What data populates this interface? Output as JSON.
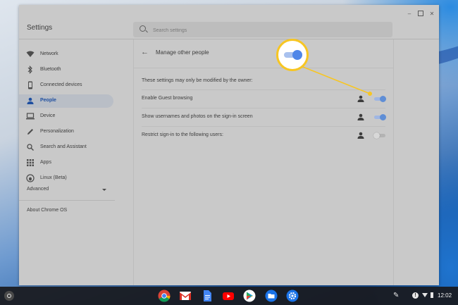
{
  "window": {
    "title": "Settings",
    "controls": {
      "minimize": "–",
      "close": "✕"
    }
  },
  "search": {
    "placeholder": "Search settings",
    "value": ""
  },
  "sidebar": {
    "items": [
      {
        "label": "Network",
        "icon": "wifi-icon",
        "active": false
      },
      {
        "label": "Bluetooth",
        "icon": "bluetooth-icon",
        "active": false
      },
      {
        "label": "Connected devices",
        "icon": "phone-icon",
        "active": false
      },
      {
        "label": "People",
        "icon": "person-icon",
        "active": true
      },
      {
        "label": "Device",
        "icon": "laptop-icon",
        "active": false
      },
      {
        "label": "Personalization",
        "icon": "pencil-icon",
        "active": false
      },
      {
        "label": "Search and Assistant",
        "icon": "search-icon",
        "active": false
      },
      {
        "label": "Apps",
        "icon": "apps-grid-icon",
        "active": false
      },
      {
        "label": "Linux (Beta)",
        "icon": "penguin-icon",
        "active": false
      }
    ],
    "advanced_label": "Advanced",
    "about_label": "About Chrome OS"
  },
  "page": {
    "back_icon": "back-arrow-icon",
    "back_glyph": "←",
    "title": "Manage other people",
    "owner_note": "These settings may only be modified by the owner:",
    "settings": [
      {
        "label": "Enable Guest browsing",
        "enabled": true,
        "icon": "person-icon"
      },
      {
        "label": "Show usernames and photos on the sign-in screen",
        "enabled": true,
        "icon": "person-icon"
      },
      {
        "label": "Restrict sign-in to the following users:",
        "enabled": false,
        "icon": "person-icon"
      }
    ]
  },
  "callout": {
    "highlights": "Enable Guest browsing toggle",
    "enabled": true
  },
  "shelf": {
    "apps": [
      "chrome-icon",
      "gmail-icon",
      "docs-icon",
      "youtube-icon",
      "play-store-icon",
      "files-icon",
      "settings-icon"
    ],
    "tray": {
      "info_glyph": "!",
      "clock": "12:02"
    }
  },
  "colors": {
    "accent": "#1f4fa0",
    "toggle_on": "#5f8ed6",
    "callout": "#f7c623",
    "shelf": "#19191c"
  }
}
